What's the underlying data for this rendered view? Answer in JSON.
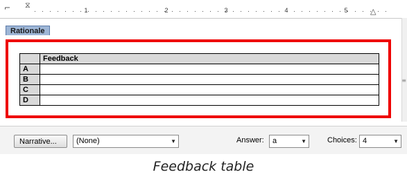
{
  "ruler": {
    "numbers": [
      "1",
      "2",
      "3",
      "4",
      "5"
    ]
  },
  "tab": {
    "label": "Rationale"
  },
  "table": {
    "header": "Feedback",
    "rows": [
      "A",
      "B",
      "C",
      "D"
    ]
  },
  "toolbar": {
    "narrative_label": "Narrative...",
    "narrative_select": "(None)",
    "answer_label": "Answer:",
    "answer_value": "a",
    "choices_label": "Choices:",
    "choices_value": "4"
  },
  "caption": "Feedback table",
  "colors": {
    "highlight": "#ee0000",
    "tab": "#9eb6d6"
  }
}
